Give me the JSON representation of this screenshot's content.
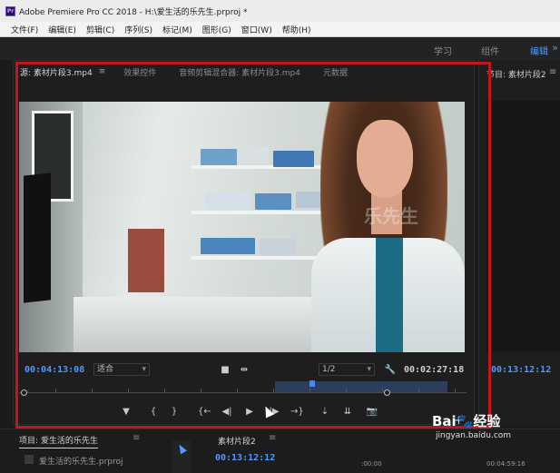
{
  "window": {
    "title": "Adobe Premiere Pro CC 2018 - H:\\爱生活的乐先生.prproj *",
    "app_icon_label": "Pr"
  },
  "menu": [
    "文件(F)",
    "编辑(E)",
    "剪辑(C)",
    "序列(S)",
    "标记(M)",
    "图形(G)",
    "窗口(W)",
    "帮助(H)"
  ],
  "workspaces": {
    "learn": "学习",
    "assembly": "组件",
    "editing": "编辑",
    "more": "»"
  },
  "source_monitor": {
    "tabs": {
      "source": "源: 素材片段3.mp4",
      "menu": "≡",
      "effect_controls": "效果控件",
      "audio_mixer": "音频剪辑混合器: 素材片段3.mp4",
      "metadata": "元数据"
    },
    "current_timecode": "00:04:13:08",
    "fit_select": "适合",
    "resolution_select": "1/2",
    "duration_timecode": "00:02:27:18"
  },
  "transport": {
    "marker": "▼",
    "mark_in": "{",
    "mark_out": "}",
    "go_to_in": "{←",
    "step_back": "◀|",
    "play": "▶",
    "step_forward": "|▶",
    "go_to_out": "→}",
    "insert": "⇣",
    "overwrite": "⇊",
    "export_frame": "📷",
    "add": "+"
  },
  "program_monitor": {
    "tab": "节目: 素材片段2",
    "menu": "≡",
    "timecode": "00:13:12:12"
  },
  "project_panel": {
    "tab": "项目: 爱生活的乐先生",
    "menu": "≡",
    "file": "爱生活的乐先生.prproj"
  },
  "sequence_panel": {
    "tab": "素材片段2",
    "menu": "≡",
    "timecode": "00:13:12:12",
    "ruler_labels": [
      ":00:00",
      "00:04:59:16"
    ]
  },
  "watermark": {
    "brand": "Bai🐾经验",
    "url": "jingyan.baidu.com",
    "video_text": "乐先生"
  },
  "colors": {
    "accent": "#4e9bff",
    "highlight_border": "#c4151c"
  }
}
